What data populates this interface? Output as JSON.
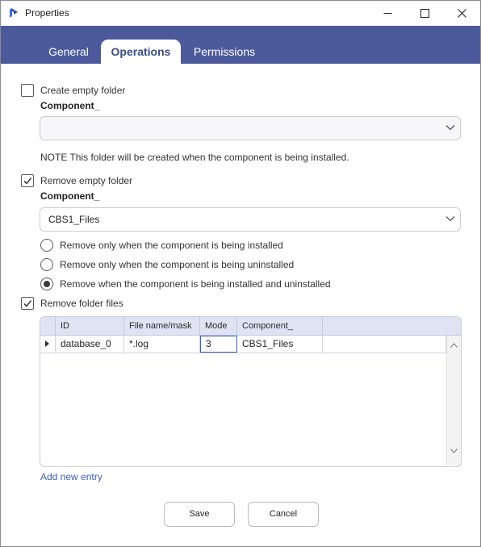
{
  "window": {
    "title": "Properties"
  },
  "tabs": [
    {
      "label": "General",
      "active": false
    },
    {
      "label": "Operations",
      "active": true
    },
    {
      "label": "Permissions",
      "active": false
    }
  ],
  "create_folder": {
    "checkbox_label": "Create empty folder",
    "checked": false,
    "component_label": "Component_",
    "component_value": "",
    "note": "NOTE This folder will be created when the component is being installed."
  },
  "remove_folder": {
    "checkbox_label": "Remove empty folder",
    "checked": true,
    "component_label": "Component_",
    "component_value": "CBS1_Files",
    "options": [
      {
        "label": "Remove only when the component is being installed",
        "selected": false
      },
      {
        "label": "Remove only when the component is being uninstalled",
        "selected": false
      },
      {
        "label": "Remove when the component is being installed and uninstalled",
        "selected": true
      }
    ]
  },
  "remove_files": {
    "checkbox_label": "Remove folder files",
    "checked": true,
    "columns": [
      "ID",
      "File name/mask",
      "Mode",
      "Component_"
    ],
    "rows": [
      {
        "id": "database_0",
        "mask": "*.log",
        "mode": "3",
        "component": "CBS1_Files"
      }
    ],
    "add_link": "Add new entry"
  },
  "buttons": {
    "save": "Save",
    "cancel": "Cancel"
  },
  "colors": {
    "tab_band": "#4c5a9c",
    "active_tab_text": "#3a4a8a",
    "link": "#3b5bb5",
    "grid_header": "#dfe3f3"
  }
}
